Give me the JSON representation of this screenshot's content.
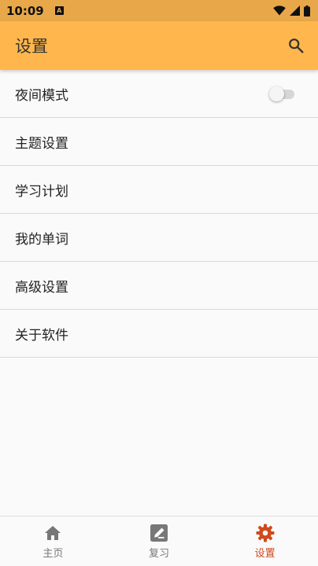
{
  "status_bar": {
    "time": "10:09",
    "notification_glyph": "A",
    "icons": [
      "wifi-icon",
      "signal-icon",
      "battery-icon"
    ]
  },
  "app_bar": {
    "title": "设置",
    "icons": [
      "search-icon"
    ]
  },
  "settings": {
    "items": [
      {
        "label": "夜间模式",
        "control": "toggle",
        "toggle_on": false
      },
      {
        "label": "主题设置"
      },
      {
        "label": "学习计划"
      },
      {
        "label": "我的单词"
      },
      {
        "label": "高级设置"
      },
      {
        "label": "关于软件"
      }
    ]
  },
  "bottom_nav": {
    "items": [
      {
        "label": "主页",
        "icon": "home-icon",
        "active": false
      },
      {
        "label": "复习",
        "icon": "edit-note-icon",
        "active": false
      },
      {
        "label": "设置",
        "icon": "gear-icon",
        "active": true
      }
    ]
  },
  "colors": {
    "status_bar": "#e8a84a",
    "app_bar": "#ffb74d",
    "active_accent": "#d04a1c",
    "inactive_nav": "#777777"
  }
}
